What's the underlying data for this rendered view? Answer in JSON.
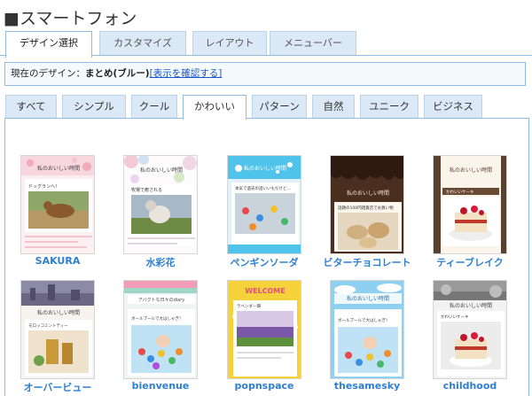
{
  "page": {
    "title": "■スマートフォン"
  },
  "main_tabs": [
    "デザイン選択",
    "カスタマイズ",
    "レイアウト",
    "メニューバー"
  ],
  "current": {
    "label": "現在のデザイン：",
    "value": "まとめ(ブルー)",
    "link": "[表示を確認する]"
  },
  "sub_tabs": [
    "すべて",
    "シンプル",
    "クール",
    "かわいい",
    "パターン",
    "自然",
    "ユニーク",
    "ビジネス"
  ],
  "designs": [
    {
      "name": "SAKURA",
      "thumb_title": "私のおいしい時間",
      "thumb_text": "ドッグランへ！"
    },
    {
      "name": "水彩花",
      "thumb_title": "私のおいしい時間",
      "thumb_text": "牧場で癒される"
    },
    {
      "name": "ペンギンソーダ",
      "thumb_title": "私のおいしい時間",
      "thumb_text": "本気で過去の話いいもだけど..."
    },
    {
      "name": "ビターチョコレート",
      "thumb_title": "私のおいしい時間",
      "thumb_text": "話題の100円雑貨店でお買い物"
    },
    {
      "name": "ティーブレイク",
      "thumb_title": "私のおいしい時間",
      "thumb_text": "かわいいケーキ"
    },
    {
      "name": "オーバービュー",
      "thumb_title": "私のおいしい時間",
      "thumb_text": "モロッコミントティー"
    },
    {
      "name": "bienvenue",
      "thumb_title": "アバクトな日々のdiary",
      "thumb_text": "ボールプールで大はしゃぎ！"
    },
    {
      "name": "popnspace",
      "thumb_title": "WELCOME",
      "thumb_text": "ラベンダー畑"
    },
    {
      "name": "thesamesky",
      "thumb_title": "私のおいしい時間",
      "thumb_text": "ボールプールで大はしゃぎ！"
    },
    {
      "name": "childhood",
      "thumb_title": "私のおいしい時間",
      "thumb_text": "かわいいケーキ"
    }
  ]
}
